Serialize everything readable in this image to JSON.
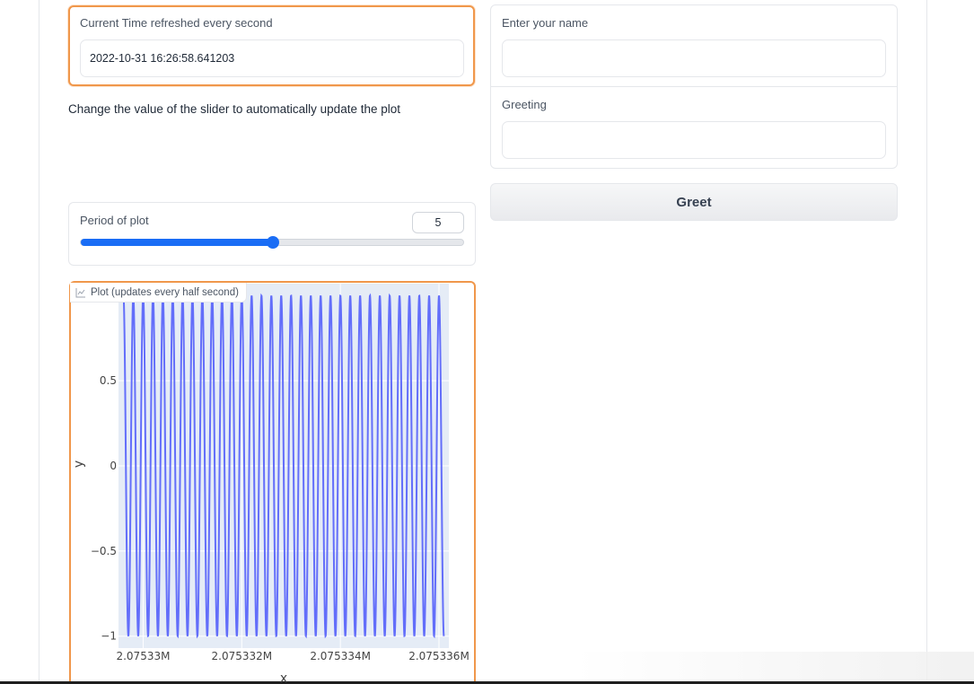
{
  "time_block": {
    "label": "Current Time refreshed every second",
    "value": "2022-10-31 16:26:58.641203"
  },
  "instructions": "Change the value of the slider to automatically update the plot",
  "slider": {
    "label": "Period of plot",
    "value": "5",
    "fraction": 0.5
  },
  "plot": {
    "badge_label": "Plot (updates every half second)",
    "badge_icon": "chart-icon"
  },
  "name_input": {
    "label": "Enter your name",
    "value": ""
  },
  "greeting_output": {
    "label": "Greeting",
    "value": ""
  },
  "greet_button": {
    "label": "Greet"
  },
  "colors": {
    "accent_orange": "#f0974b",
    "slider_blue": "#1a6df5",
    "plot_line": "#636efa",
    "plot_bg": "#e5ecf6"
  },
  "chart_data": {
    "type": "line",
    "title": "",
    "xlabel": "x",
    "ylabel": "y",
    "xlim": [
      2075329.5,
      2075336.2
    ],
    "ylim": [
      -1.07,
      1.07
    ],
    "xticks": [
      {
        "value": 2075330,
        "label": "2.07533M"
      },
      {
        "value": 2075332,
        "label": "2.075332M"
      },
      {
        "value": 2075334,
        "label": "2.075334M"
      },
      {
        "value": 2075336,
        "label": "2.075336M"
      }
    ],
    "yticks": [
      {
        "value": 0.5,
        "label": "0.5"
      },
      {
        "value": 0,
        "label": "0"
      },
      {
        "value": -0.5,
        "label": "−0.5"
      },
      {
        "value": -1,
        "label": "−1"
      }
    ],
    "series": [
      {
        "function": "sin",
        "cycles_per_unit": 5,
        "x_start": 2075329.6,
        "x_end": 2075336.1
      }
    ],
    "grid": true
  }
}
